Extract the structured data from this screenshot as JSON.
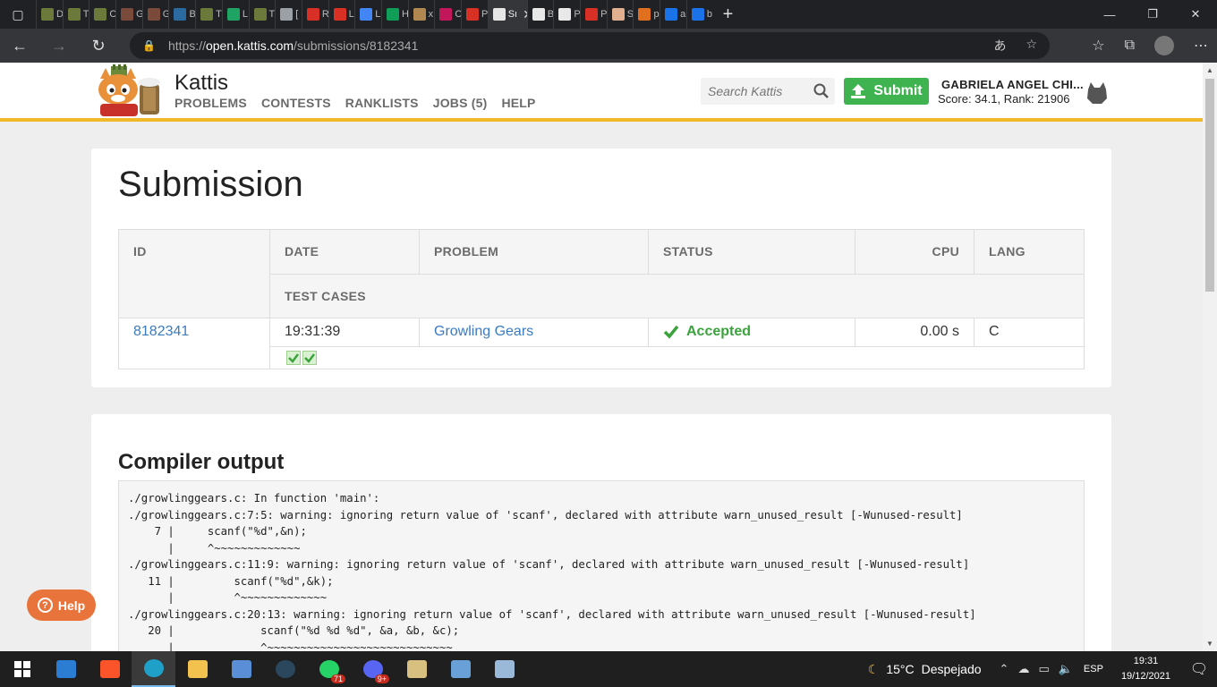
{
  "browser": {
    "tabs": [
      {
        "letter": "D",
        "color": "#6b7a3a"
      },
      {
        "letter": "T",
        "color": "#6b7a3a"
      },
      {
        "letter": "C",
        "color": "#6b7a3a"
      },
      {
        "letter": "G",
        "color": "#7a4a3a"
      },
      {
        "letter": "G",
        "color": "#7a4a3a"
      },
      {
        "letter": "B",
        "color": "#2a6aa0"
      },
      {
        "letter": "T",
        "color": "#6b7a3a"
      },
      {
        "letter": "L",
        "color": "#1fa463"
      },
      {
        "letter": "T",
        "color": "#6b7a3a"
      },
      {
        "letter": "[",
        "color": "#9aa0a6"
      },
      {
        "letter": "R",
        "color": "#d93025"
      },
      {
        "letter": "L",
        "color": "#d93025"
      },
      {
        "letter": "L",
        "color": "#4285f4"
      },
      {
        "letter": "H",
        "color": "#0f9d58"
      },
      {
        "letter": "x",
        "color": "#b08850"
      },
      {
        "letter": "C",
        "color": "#c2185b"
      },
      {
        "letter": "P",
        "color": "#d93025"
      }
    ],
    "active_tab": {
      "letter": "Sı",
      "close": "✕"
    },
    "tabs_after": [
      {
        "letter": "B",
        "color": "#e8e8e8"
      },
      {
        "letter": "P",
        "color": "#e8e8e8"
      },
      {
        "letter": "P",
        "color": "#d93025"
      },
      {
        "letter": "S",
        "color": "#e0b090"
      },
      {
        "letter": "p",
        "color": "#e07020"
      },
      {
        "letter": "a",
        "color": "#1a73e8"
      },
      {
        "letter": "b",
        "color": "#1a73e8"
      }
    ],
    "url_prefix": "https://",
    "url_host": "open.kattis.com",
    "url_path": "/submissions/8182341"
  },
  "header": {
    "brand": "Kattis",
    "nav": [
      "PROBLEMS",
      "CONTESTS",
      "RANKLISTS",
      "JOBS (5)",
      "HELP"
    ],
    "search_placeholder": "Search Kattis",
    "submit_label": "Submit",
    "user_name": "GABRIELA ANGEL CHI...",
    "user_score": "Score: 34.1, Rank: 21906"
  },
  "submission": {
    "title": "Submission",
    "columns": {
      "id": "ID",
      "date": "DATE",
      "problem": "PROBLEM",
      "status": "STATUS",
      "cpu": "CPU",
      "lang": "LANG",
      "test_cases": "TEST CASES"
    },
    "row": {
      "id": "8182341",
      "date": "19:31:39",
      "problem": "Growling Gears",
      "status": "Accepted",
      "cpu": "0.00 s",
      "lang": "C"
    },
    "test_cases_passed": 2
  },
  "compiler": {
    "title": "Compiler output",
    "lines": [
      "./growlinggears.c: In function 'main':",
      "./growlinggears.c:7:5: warning: ignoring return value of 'scanf', declared with attribute warn_unused_result [-Wunused-result]",
      "    7 |     scanf(\"%d\",&n);",
      "      |     ^~~~~~~~~~~~~~",
      "./growlinggears.c:11:9: warning: ignoring return value of 'scanf', declared with attribute warn_unused_result [-Wunused-result]",
      "   11 |         scanf(\"%d\",&k);",
      "      |         ^~~~~~~~~~~~~~",
      "./growlinggears.c:20:13: warning: ignoring return value of 'scanf', declared with attribute warn_unused_result [-Wunused-result]",
      "   20 |             scanf(\"%d %d %d\", &a, &b, &c);",
      "      |             ^~~~~~~~~~~~~~~~~~~~~~~~~~~~~"
    ]
  },
  "help_button": "Help",
  "taskbar": {
    "weather_temp": "15°C",
    "weather_text": "Despejado",
    "lang": "ESP",
    "time": "19:31",
    "date": "19/12/2021",
    "whatsapp_badge": "71",
    "discord_badge": "9+"
  }
}
